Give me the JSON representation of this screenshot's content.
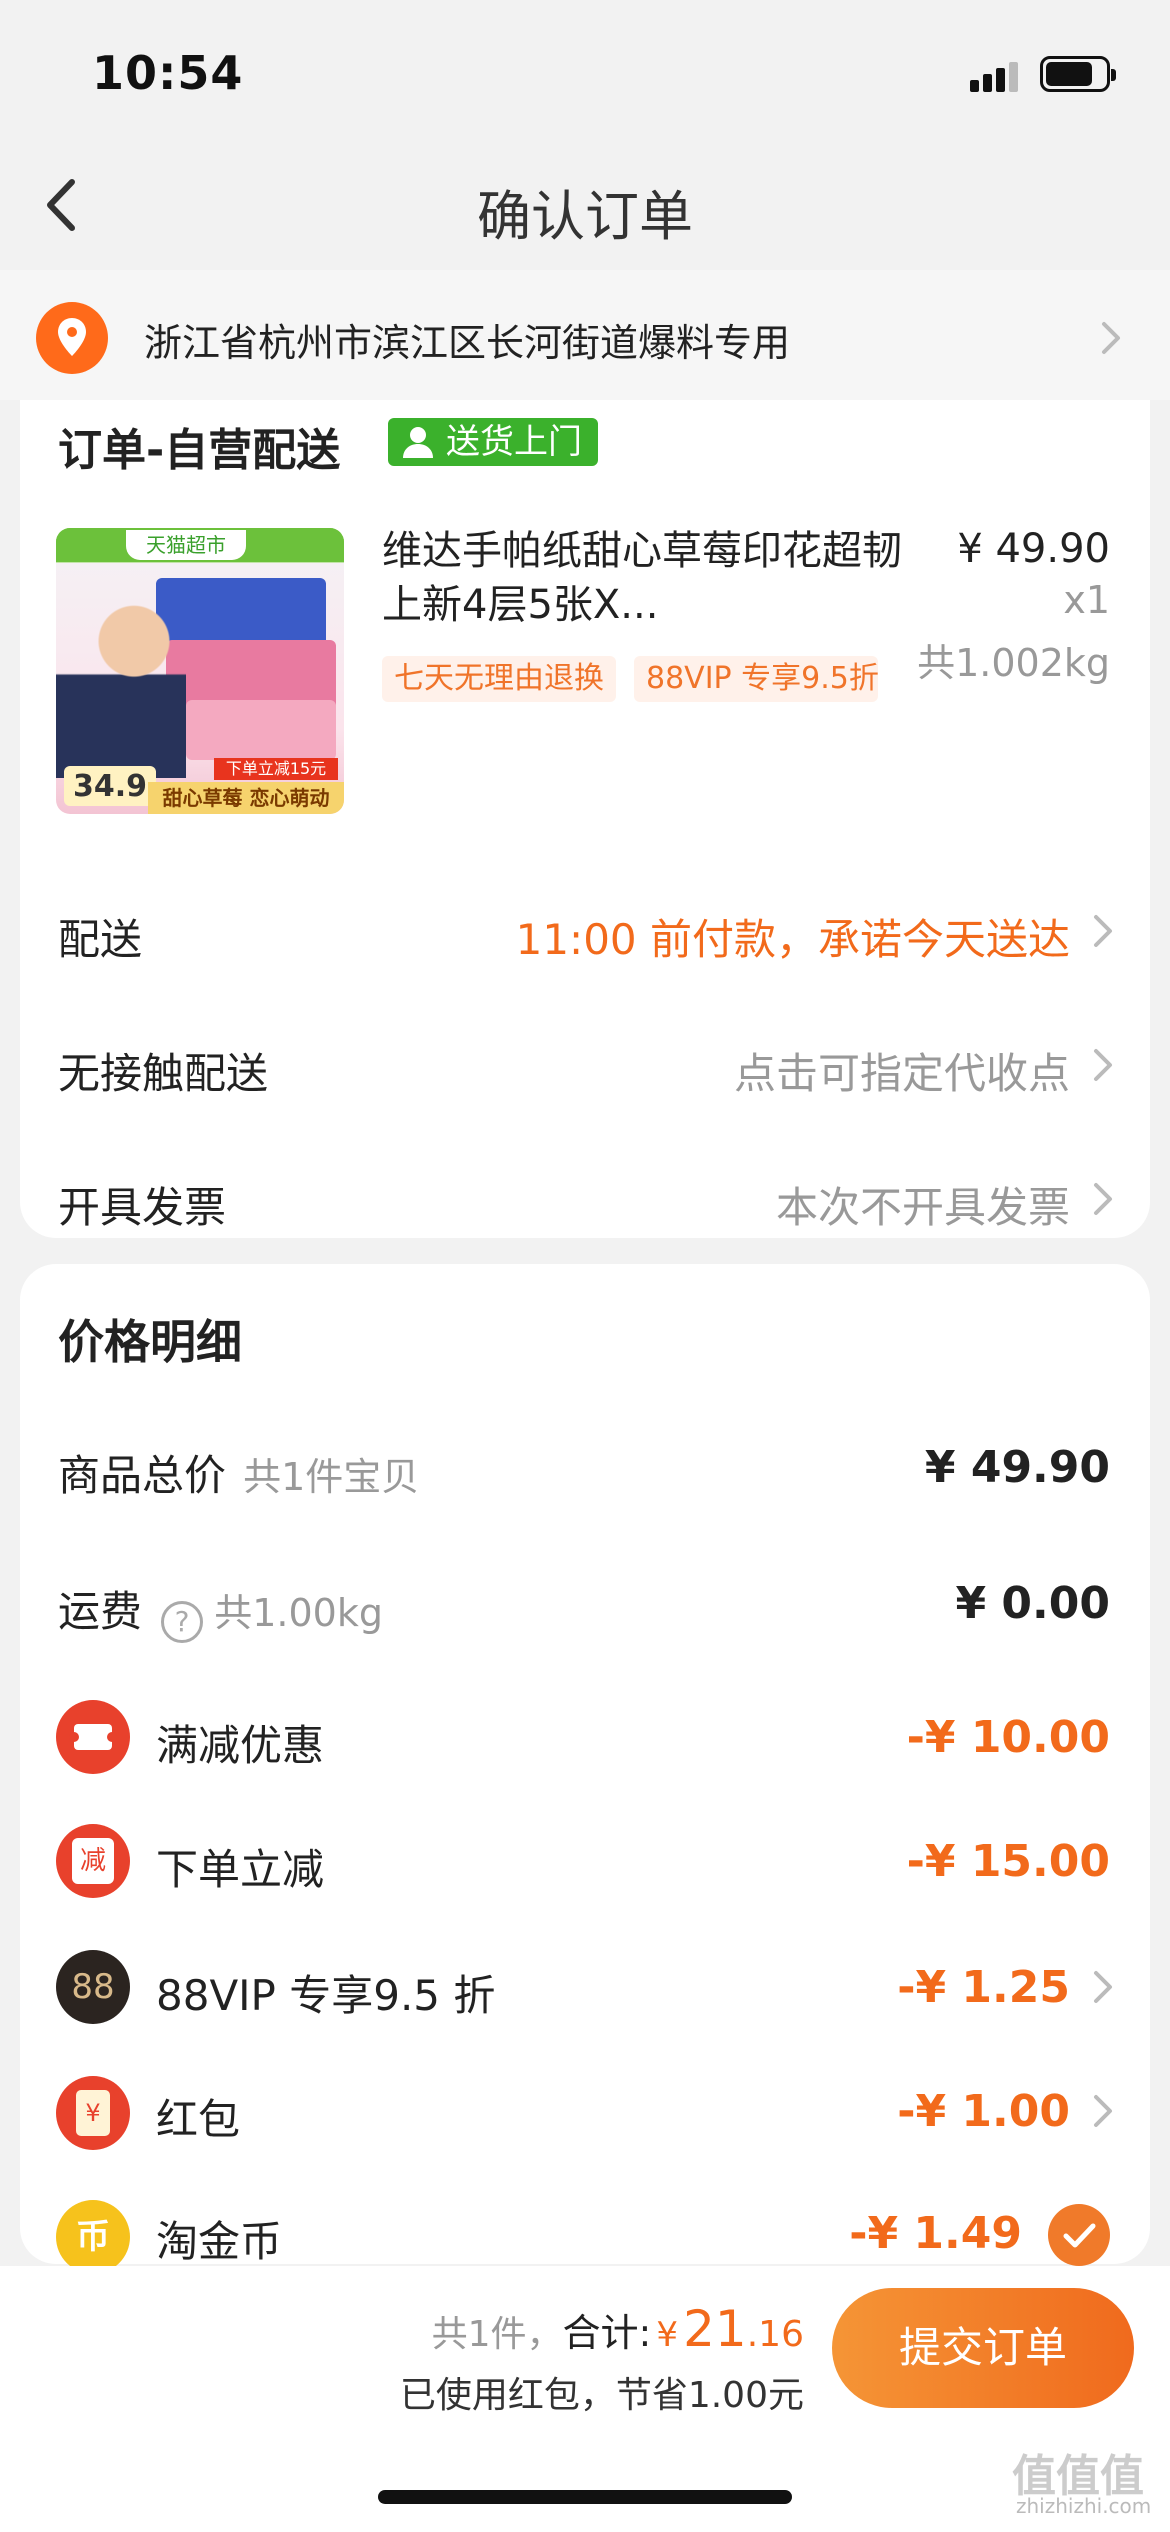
{
  "status_bar": {
    "time": "10:54"
  },
  "nav": {
    "title": "确认订单"
  },
  "address": {
    "text": "浙江省杭州市滨江区长河街道爆料专用"
  },
  "order": {
    "title": "订单-自营配送",
    "delivery_badge": "送货上门",
    "product": {
      "image_header_tag": "天猫超市",
      "image_price": "34.9",
      "image_red_label": "下单立减15元",
      "image_slogan": "甜心草莓 恋心萌动",
      "name": "维达手帕纸甜心草莓印花超韧上新4层5张X...",
      "price": "¥ 49.90",
      "qty": "x1",
      "weight": "共1.002kg",
      "tags": [
        "七天无理由退换",
        "88VIP 专享9.5折"
      ]
    },
    "rows": [
      {
        "label": "配送",
        "value": "11:00 前付款，承诺今天送达"
      },
      {
        "label": "无接触配送",
        "value": "点击可指定代收点"
      },
      {
        "label": "开具发票",
        "value": "本次不开具发票"
      }
    ]
  },
  "price_detail": {
    "title": "价格明细",
    "goods_total": {
      "label": "商品总价",
      "sub": "共1件宝贝",
      "value": "¥ 49.90"
    },
    "shipping": {
      "label": "运费",
      "sub": "共1.00kg",
      "value": "¥ 0.00"
    },
    "discounts": [
      {
        "label": "满减优惠",
        "value": "-¥ 10.00",
        "icon": "ticket-icon",
        "color": "#e8412c"
      },
      {
        "label": "下单立减",
        "value": "-¥ 15.00",
        "icon": "jian-icon",
        "color": "#e8412c",
        "glyph": "减"
      },
      {
        "label": "88VIP 专享9.5 折",
        "value": "-¥ 1.25",
        "icon": "vip88-icon",
        "color": "#2b2420",
        "glyph": "88"
      },
      {
        "label": "红包",
        "value": "-¥ 1.00",
        "icon": "red-envelope-icon",
        "color": "#e8412c",
        "glyph": "¥"
      },
      {
        "label": "淘金币",
        "value": "-¥ 1.49",
        "icon": "coin-icon",
        "color": "#f6c21c",
        "glyph": "币"
      }
    ]
  },
  "bottom": {
    "count": "共1件，",
    "total_label": "合计:",
    "yen": "¥",
    "total_int": "21",
    "total_dec": ".16",
    "saved": "已使用红包，节省1.00元",
    "submit": "提交订单"
  },
  "colors": {
    "accent": "#f26a1b",
    "badge_green": "#3bb12c"
  },
  "watermark": {
    "chars": "值值值",
    "site": "zhizhizhi.com"
  }
}
